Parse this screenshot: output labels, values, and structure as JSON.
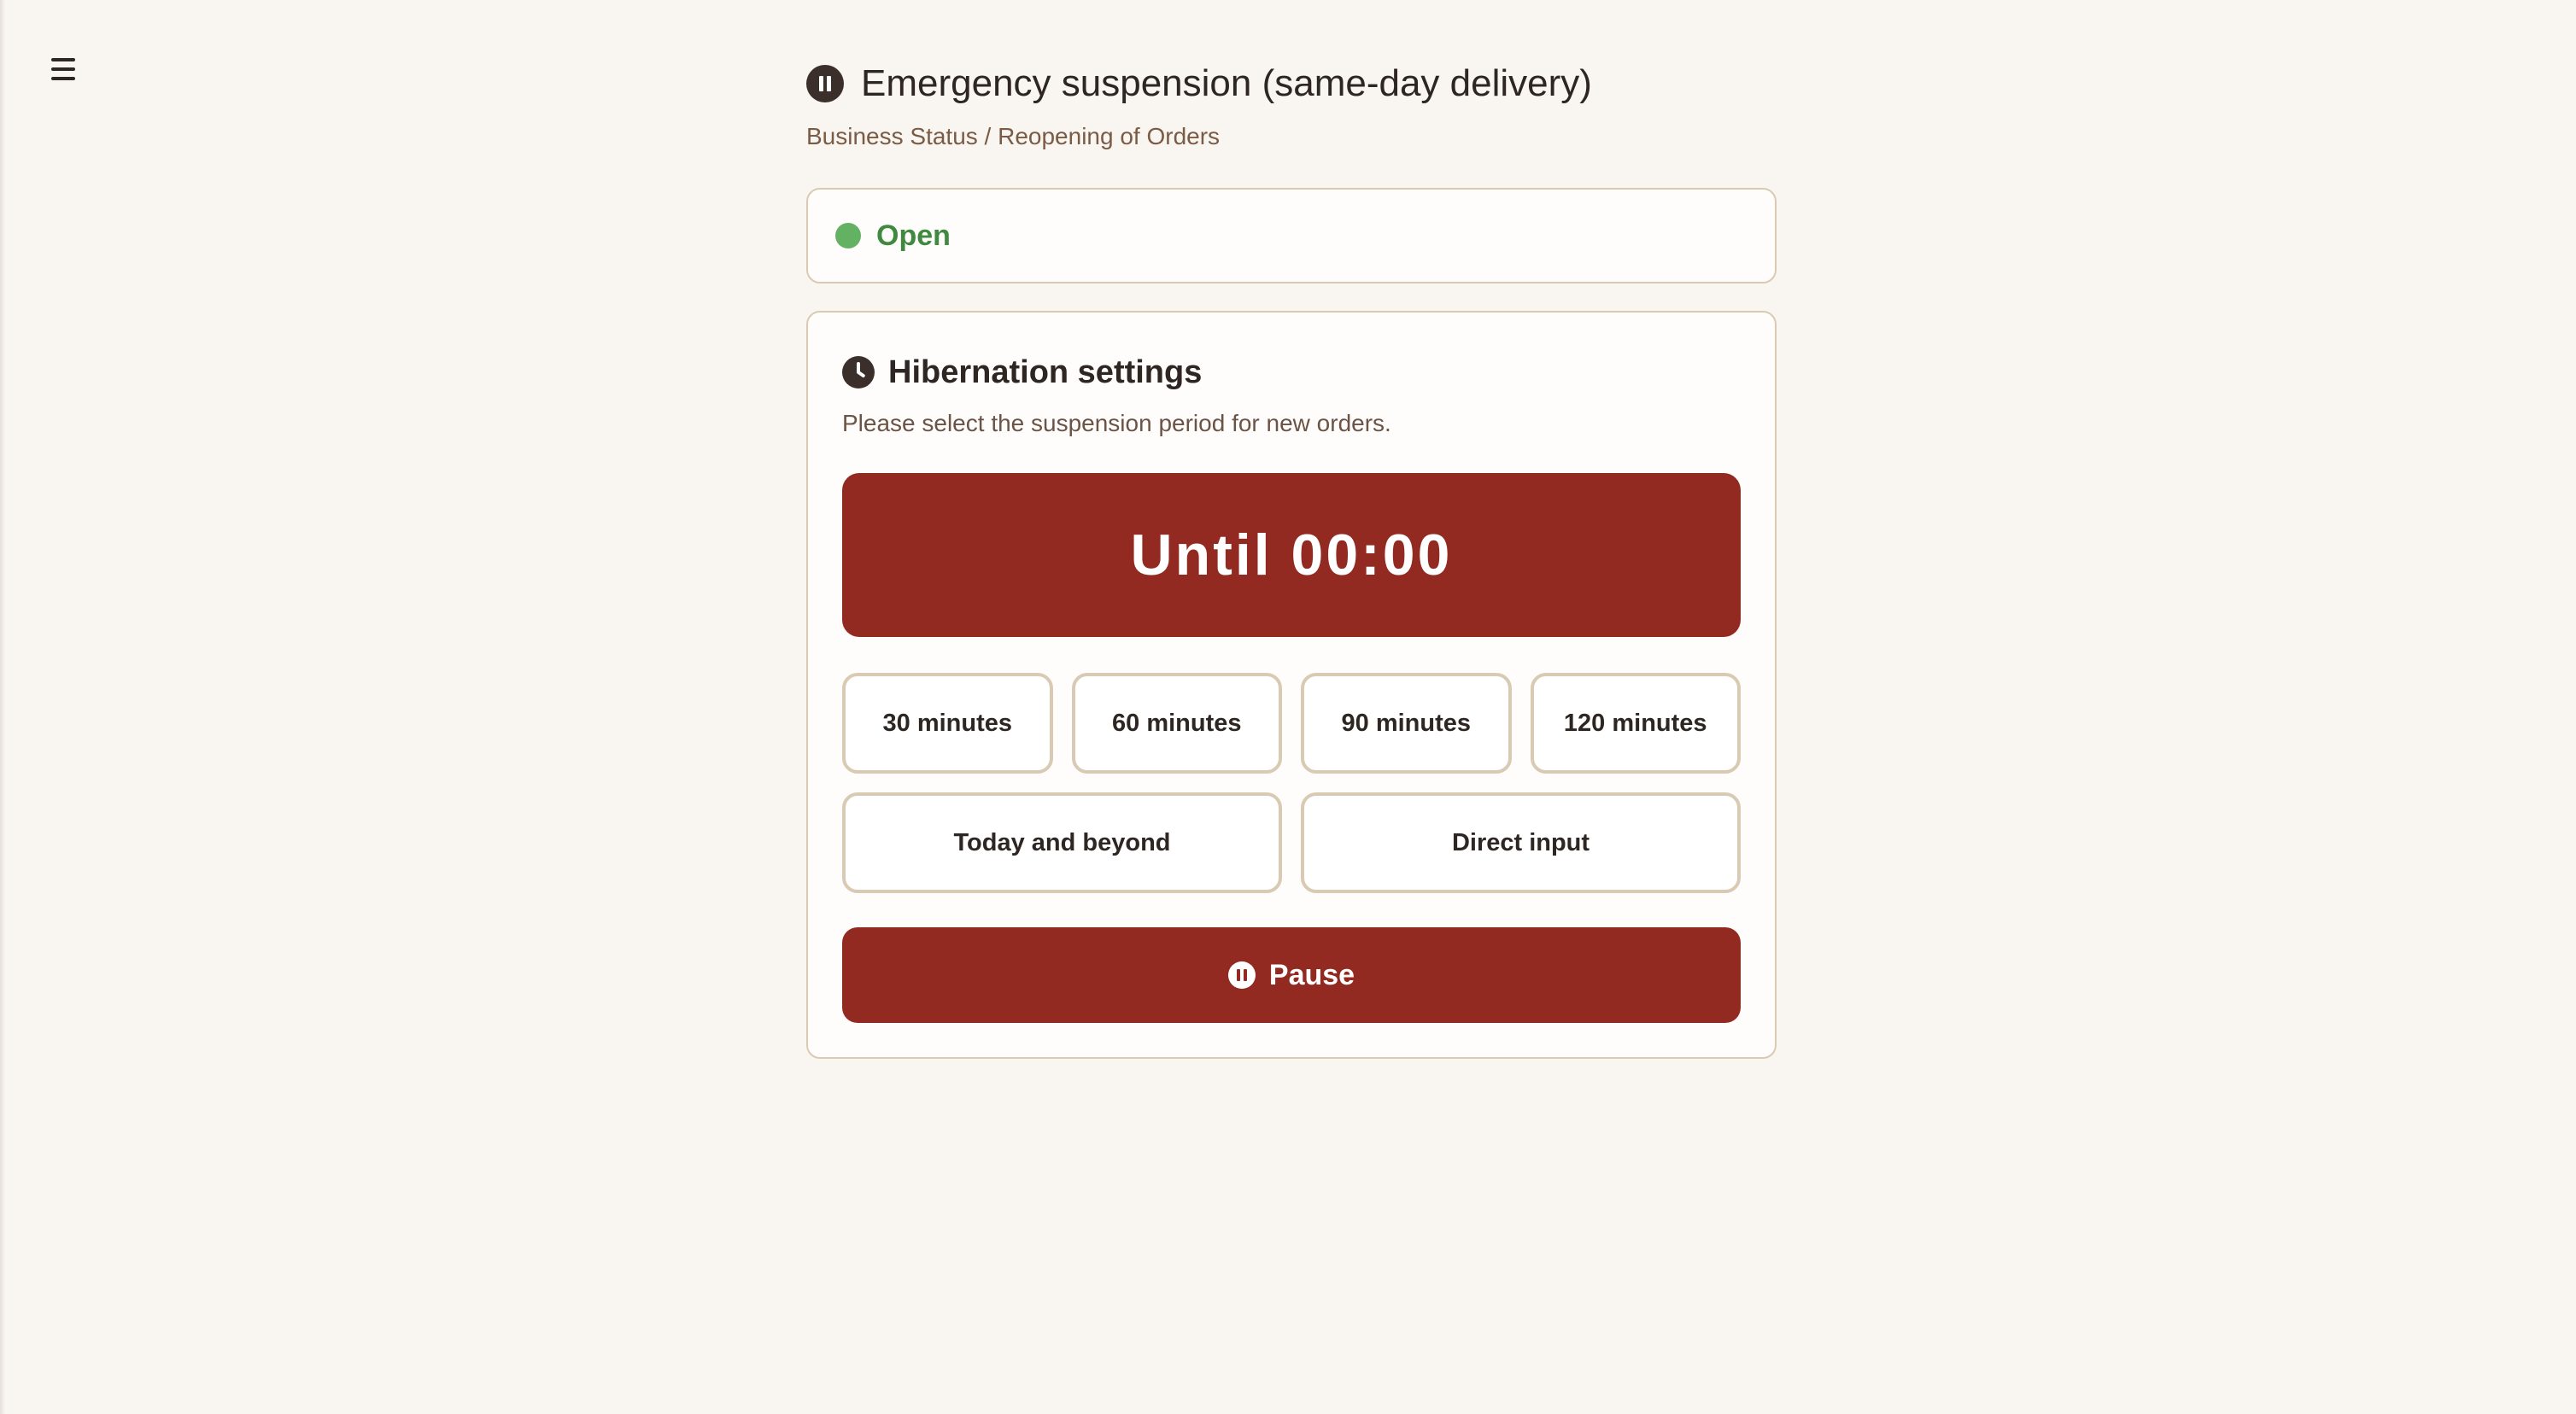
{
  "header": {
    "menu_icon": "hamburger-menu-icon",
    "title_icon": "pause-circle-icon",
    "title": "Emergency suspension (same-day delivery)",
    "breadcrumb": "Business Status / Reopening of Orders"
  },
  "status": {
    "label": "Open",
    "dot_color": "#63b162"
  },
  "hibernation": {
    "icon": "clock-icon",
    "title": "Hibernation settings",
    "description": "Please select the suspension period for new orders.",
    "selected_display": "Until 00:00",
    "options_row1": [
      "30 minutes",
      "60 minutes",
      "90 minutes",
      "120 minutes"
    ],
    "options_row2": [
      "Today and beyond",
      "Direct input"
    ],
    "pause_button": {
      "icon": "pause-circle-icon",
      "label": "Pause"
    }
  },
  "colors": {
    "accent": "#922a22",
    "background": "#f9f5f1",
    "border": "#d9cbb3",
    "status_open": "#3f8a3f"
  }
}
